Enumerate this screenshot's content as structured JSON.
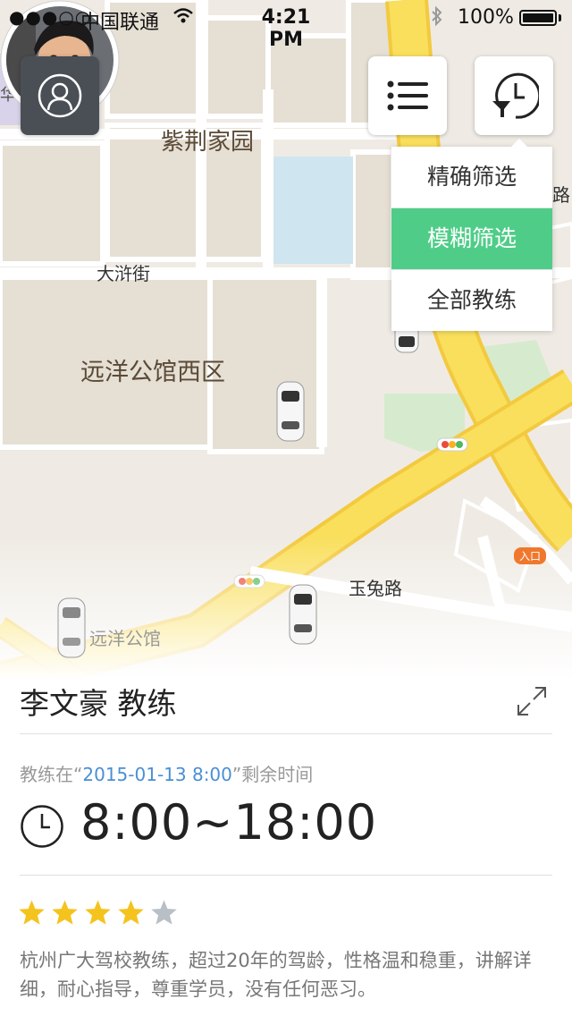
{
  "status_bar": {
    "signal": "●●●○○",
    "carrier": "中国联通",
    "time": "4:21 PM",
    "battery": "100%"
  },
  "map": {
    "labels": {
      "zijing": "紫荆家园",
      "daxu": "大浒街",
      "yuanyang_west": "远洋公馆西区",
      "yutu": "玉兔路",
      "yuanyang": "远洋公馆",
      "entrance": "入口",
      "edge_left": "华联",
      "edge_right": "路"
    },
    "colors": {
      "road_main": "#f7d94a",
      "road_secondary": "#ffffff",
      "block": "#e8e2d8",
      "water": "#cfe5ef",
      "green": "#d6ebcd"
    }
  },
  "buttons": {
    "profile_icon": "user-icon",
    "list_icon": "list-icon",
    "history_icon": "history-filter-icon"
  },
  "filter_menu": {
    "items": [
      {
        "label": "精确筛选",
        "active": false
      },
      {
        "label": "模糊筛选",
        "active": true
      },
      {
        "label": "全部教练",
        "active": false
      }
    ],
    "active_color": "#4fcd88"
  },
  "coach": {
    "name": "李文豪 教练",
    "remain_prefix": "教练在“",
    "remain_date": "2015-01-13 8:00",
    "remain_suffix": "”剩余时间",
    "hours": "8:00~18:00",
    "rating": 4,
    "rating_max": 5,
    "description": "杭州广大驾校教练，超过20年的驾龄，性格温和稳重，讲解详细，耐心指导，尊重学员，没有任何恶习。"
  }
}
